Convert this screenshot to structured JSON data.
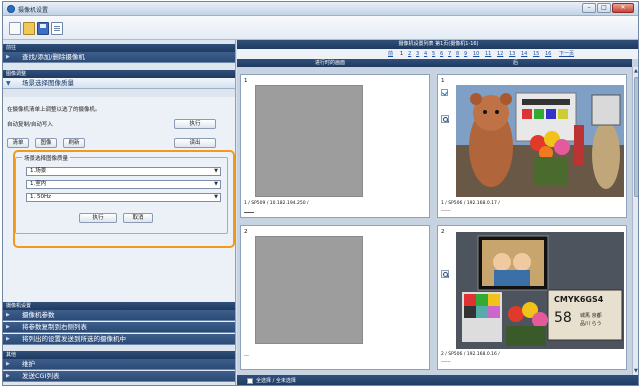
{
  "window": {
    "title": "摄像机设置",
    "minimize": "–",
    "maximize": "□",
    "close": "✕"
  },
  "toolbar": {
    "icons": [
      "new-file-icon",
      "open-folder-icon",
      "save-icon",
      "document-icon"
    ]
  },
  "sidebar": {
    "section_top": "前往",
    "find_item": "查找/添加/删除摄像机",
    "section_adjust": "图像调整",
    "scene_item": "场景选择图像质量",
    "hint": "在摄像机清单上调整以选了的摄像机。",
    "auto_label": "自动复制/自动写入",
    "execute_top": "执行",
    "btn_clear": "清单",
    "btn_image": "图像",
    "btn_refresh": "刷新",
    "btn_read": "读出",
    "fieldset_legend": "场景选择图像质量",
    "select_1": "1.场景",
    "select_2": "1.室内",
    "select_3": "1. 50Hz",
    "btn_execute": "执行",
    "btn_cancel": "取消",
    "section_camera": "摄像机设置",
    "cam_item_1": "摄像机参数",
    "cam_item_2": "将参数复制到右侧列表",
    "cam_item_3": "将列出的设置发送到所选的摄像机中",
    "section_other": "其他",
    "other_item_1": "维护",
    "other_item_2": "发送CGI列表"
  },
  "list": {
    "header": "摄像机设置列表 第1页(摄像机1-16)",
    "pager_prev": "前",
    "pages": [
      "1",
      "2",
      "3",
      "4",
      "5",
      "6",
      "7",
      "8",
      "9",
      "10",
      "11",
      "12",
      "13",
      "14",
      "15",
      "16"
    ],
    "pager_next": "下一页",
    "col_left": "进行时的画面",
    "col_right": "后",
    "cells": [
      {
        "num": "1",
        "caption": "1 / SP509 / 10.182.194.250 /"
      },
      {
        "num": "1",
        "caption": "1 / SP506 / 192.168.0.17 /",
        "sub": "------"
      },
      {
        "num": "2",
        "caption": "---"
      },
      {
        "num": "2",
        "caption": "2 / SP506 / 192.168.0.16 /",
        "sub": "------"
      }
    ],
    "photo2_text_1": "CMYK6GS4",
    "photo2_text_2": "58",
    "photo2_text_3": "城馬 京都",
    "photo2_text_4": "品川 らう",
    "footer_label": "全选择 / 全未选择"
  }
}
